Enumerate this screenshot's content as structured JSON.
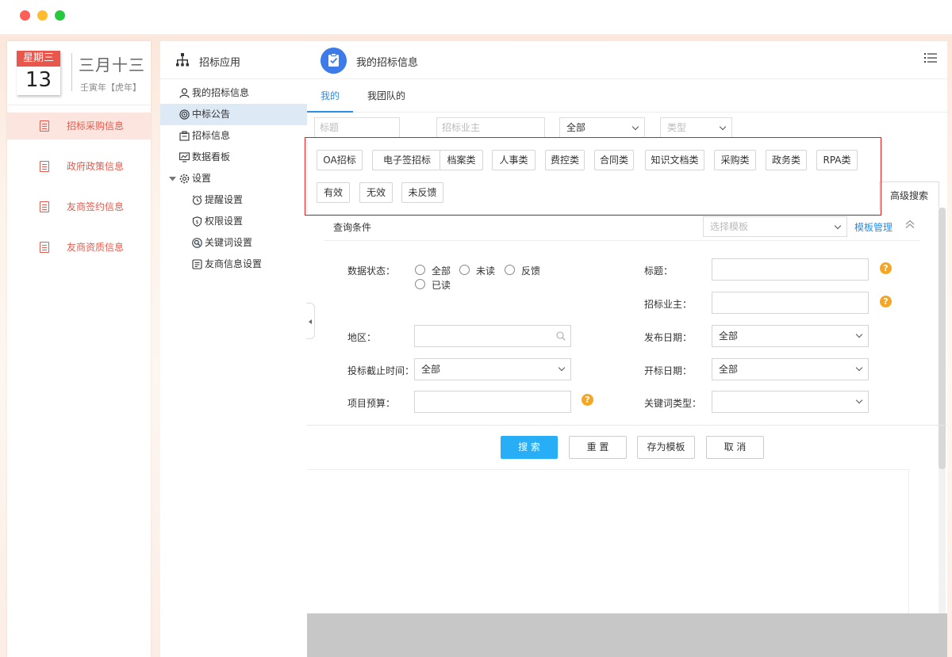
{
  "window": {
    "controls": [
      "close",
      "minimize",
      "maximize"
    ]
  },
  "calendar": {
    "weekday": "星期三",
    "day": "13",
    "lunar": "三月十三",
    "year": "壬寅年【虎年】"
  },
  "left_nav": {
    "items": [
      {
        "label": "招标采购信息",
        "active": true
      },
      {
        "label": "政府政策信息",
        "active": false
      },
      {
        "label": "友商签约信息",
        "active": false
      },
      {
        "label": "友商资质信息",
        "active": false
      }
    ]
  },
  "app_sidebar": {
    "title": "招标应用",
    "items": [
      {
        "label": "我的招标信息",
        "icon": "user-icon"
      },
      {
        "label": "中标公告",
        "icon": "target-icon",
        "active": true
      },
      {
        "label": "招标信息",
        "icon": "briefcase-icon"
      },
      {
        "label": "数据看板",
        "icon": "chart-icon"
      },
      {
        "label": "设置",
        "icon": "gear-icon"
      },
      {
        "label": "提醒设置",
        "icon": "alarm-icon"
      },
      {
        "label": "权限设置",
        "icon": "shield-icon"
      },
      {
        "label": "关键词设置",
        "icon": "search-icon"
      },
      {
        "label": "友商信息设置",
        "icon": "doc-icon"
      }
    ]
  },
  "main": {
    "title": "我的招标信息",
    "tabs": [
      "我的",
      "我团队的"
    ],
    "filters": {
      "title_placeholder": "标题",
      "owner_placeholder": "招标业主",
      "scope_value": "全部",
      "type_placeholder": "类型"
    },
    "tags": [
      "OA招标",
      "电子签招标",
      "档案类",
      "人事类",
      "费控类",
      "合同类",
      "知识文档类",
      "采购类",
      "政务类",
      "RPA类",
      "有效",
      "无效",
      "未反馈"
    ],
    "advanced_tab": "高级搜索",
    "query": {
      "title": "查询条件",
      "template_placeholder": "选择模板",
      "template_manage": "模板管理",
      "labels": {
        "data_status": "数据状态：",
        "title": "标题：",
        "owner": "招标业主：",
        "region": "地区：",
        "publish_date": "发布日期：",
        "deadline": "投标截止时间：",
        "open_date": "开标日期：",
        "budget": "项目预算：",
        "keyword_type": "关键词类型："
      },
      "status_options": [
        "全部",
        "未读",
        "反馈",
        "已读"
      ],
      "values": {
        "publish_date": "全部",
        "deadline": "全部",
        "open_date": "全部",
        "keyword_type": ""
      },
      "help_glyph": "?"
    },
    "buttons": {
      "search": "搜 索",
      "reset": "重 置",
      "save_template": "存为模板",
      "cancel": "取 消"
    }
  },
  "colors": {
    "accent": "#2b8ee8",
    "primary_button": "#27aef7",
    "left_nav_red": "#e45c4f",
    "highlight": "#e02020",
    "help": "#f5a623"
  }
}
